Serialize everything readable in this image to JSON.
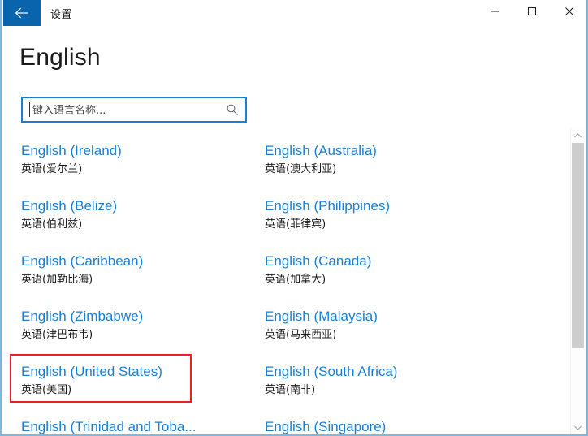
{
  "window": {
    "app_title": "设置",
    "back_icon": "back-arrow-icon",
    "minimize_label": "—",
    "maximize_label": "▢",
    "close_label": "✕",
    "border_color": "#7eb8e0",
    "accent_color": "#0a64ad"
  },
  "page": {
    "title": "English",
    "link_color": "#1a7fd4",
    "highlight_color": "#ee1c25"
  },
  "search": {
    "placeholder": "键入语言名称...",
    "value": "",
    "icon": "search-icon"
  },
  "languages": [
    {
      "en": "English (Ireland)",
      "zh": "英语(爱尔兰)",
      "col": 0,
      "row": 0,
      "highlighted": false
    },
    {
      "en": "English (Australia)",
      "zh": "英语(澳大利亚)",
      "col": 1,
      "row": 0,
      "highlighted": false
    },
    {
      "en": "English (Belize)",
      "zh": "英语(伯利兹)",
      "col": 0,
      "row": 1,
      "highlighted": false
    },
    {
      "en": "English (Philippines)",
      "zh": "英语(菲律宾)",
      "col": 1,
      "row": 1,
      "highlighted": false
    },
    {
      "en": "English (Caribbean)",
      "zh": "英语(加勒比海)",
      "col": 0,
      "row": 2,
      "highlighted": false
    },
    {
      "en": "English (Canada)",
      "zh": "英语(加拿大)",
      "col": 1,
      "row": 2,
      "highlighted": false
    },
    {
      "en": "English (Zimbabwe)",
      "zh": "英语(津巴布韦)",
      "col": 0,
      "row": 3,
      "highlighted": false
    },
    {
      "en": "English (Malaysia)",
      "zh": "英语(马来西亚)",
      "col": 1,
      "row": 3,
      "highlighted": false
    },
    {
      "en": "English (United States)",
      "zh": "英语(美国)",
      "col": 0,
      "row": 4,
      "highlighted": true
    },
    {
      "en": "English (South Africa)",
      "zh": "英语(南非)",
      "col": 1,
      "row": 4,
      "highlighted": false
    },
    {
      "en": "English (Trinidad and Toba...",
      "zh": "",
      "col": 0,
      "row": 5,
      "highlighted": false
    },
    {
      "en": "English (Singapore)",
      "zh": "",
      "col": 1,
      "row": 5,
      "highlighted": false
    }
  ],
  "scrollbar": {
    "up_arrow": "▲",
    "down_arrow": "▼",
    "thumb_position_percent": 0
  }
}
